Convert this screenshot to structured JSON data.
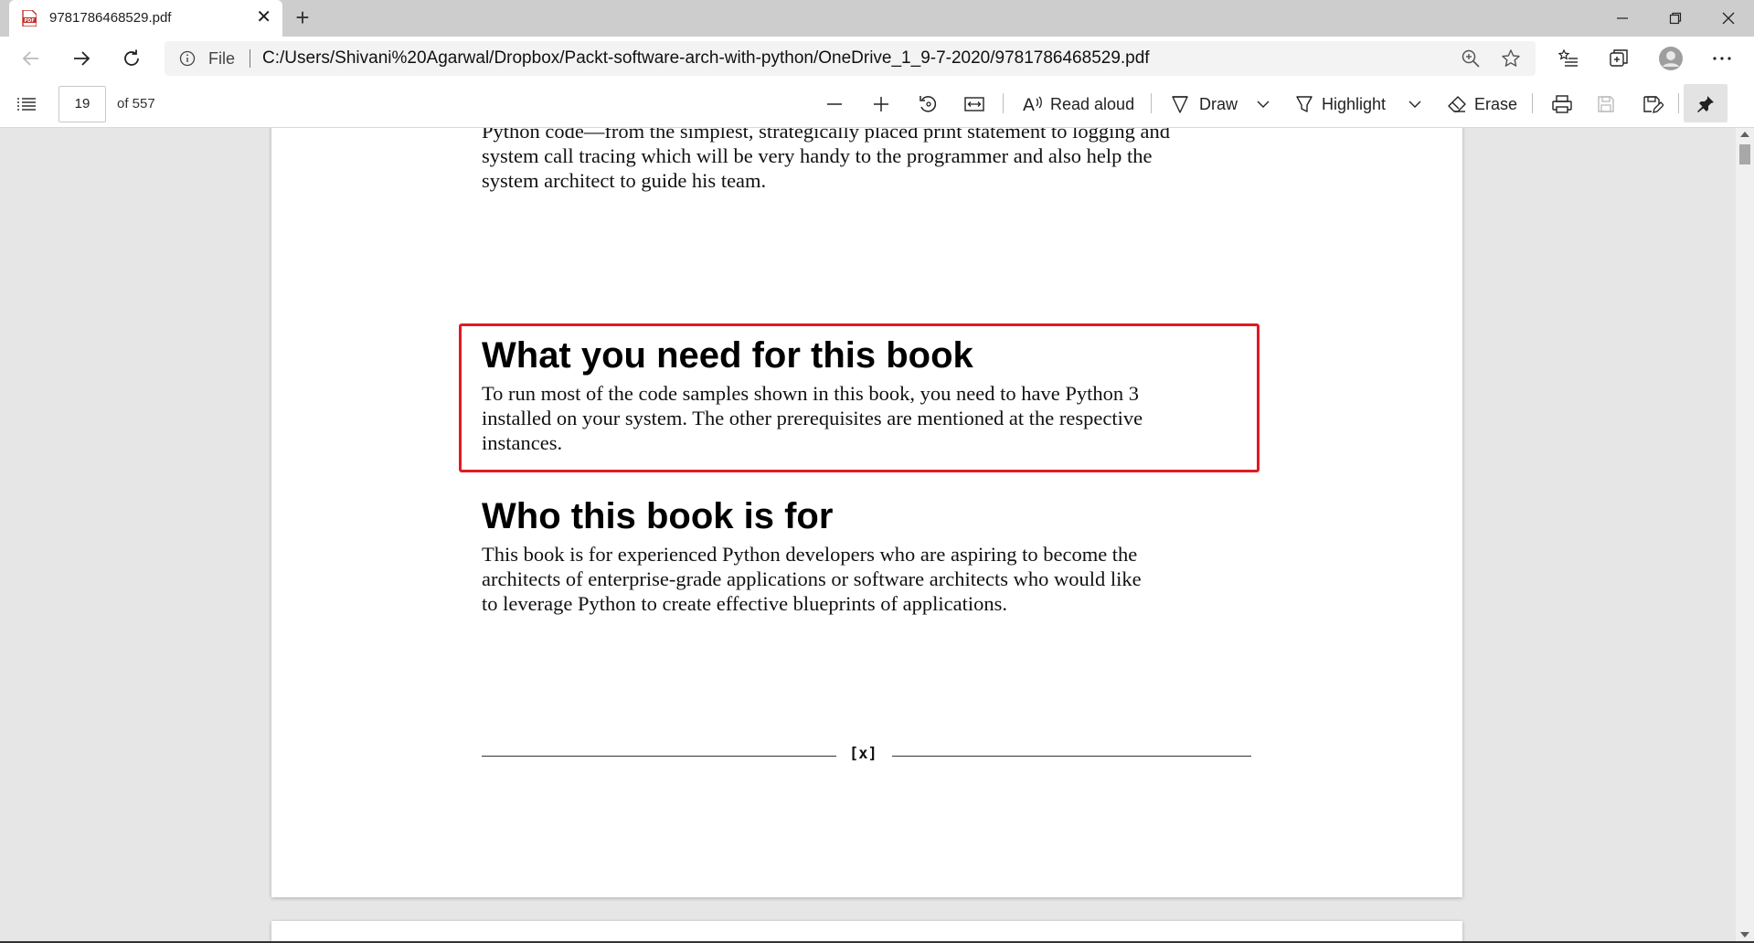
{
  "tab": {
    "title": "9781786468529.pdf",
    "file_icon": "pdf-file-icon"
  },
  "address": {
    "scheme_label": "File",
    "url": "C:/Users/Shivani%20Agarwal/Dropbox/Packt-software-arch-with-python/OneDrive_1_9-7-2020/9781786468529.pdf"
  },
  "pdf_toolbar": {
    "page_current": "19",
    "page_total": "of 557",
    "read_aloud": "Read aloud",
    "draw": "Draw",
    "highlight": "Highlight",
    "erase": "Erase"
  },
  "document": {
    "intro_lines": [
      "Python code—from the simplest, strategically placed print statement to logging and",
      "system call tracing which will be very handy to the programmer and also help the",
      "system architect to guide his team."
    ],
    "section1_heading": "What you need for this book",
    "section1_lines": [
      "To run most of the code samples shown in this book, you need to have Python 3",
      "installed on your system. The other prerequisites are mentioned at the respective",
      "instances."
    ],
    "section2_heading": "Who this book is for",
    "section2_lines": [
      "This book is for experienced Python developers who are aspiring to become the",
      "architects of enterprise-grade applications or software architects who would like",
      "to leverage Python to create effective blueprints of applications."
    ],
    "page_footer": "[x]"
  },
  "colors": {
    "highlight_box": "#e11b22",
    "tabbar": "#cdcdcd",
    "viewer_bg": "#e6e6e6"
  }
}
